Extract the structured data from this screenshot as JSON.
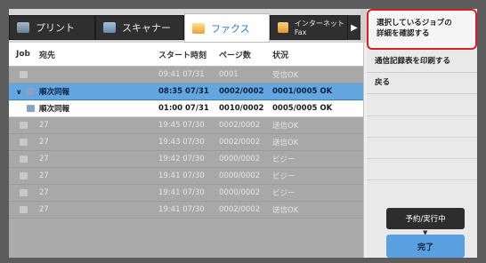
{
  "tabs": [
    {
      "label": "プリント",
      "icon": "printer-icon"
    },
    {
      "label": "スキャナー",
      "icon": "scanner-icon"
    },
    {
      "label": "ファクス",
      "icon": "fax-icon",
      "active": true
    },
    {
      "label": "インターネットFax",
      "icon": "internet-fax-icon"
    }
  ],
  "tab_more": "▶",
  "table": {
    "headers": [
      "Job",
      "宛先",
      "スタート時刻",
      "ページ数",
      "状況"
    ],
    "rows": [
      {
        "dest": "",
        "time": "09:41 07/31",
        "pages": "0001",
        "status": "受信OK",
        "style": "dim"
      },
      {
        "dest": "順次同報",
        "time": "08:35 07/31",
        "pages": "0002/0002",
        "status": "0001/0005 OK",
        "style": "sel"
      },
      {
        "dest": "順次同報",
        "time": "01:00 07/31",
        "pages": "0010/0002",
        "status": "0005/0005 OK",
        "style": "white"
      },
      {
        "dest": "27",
        "time": "19:45 07/30",
        "pages": "0002/0002",
        "status": "送信OK",
        "style": "dim"
      },
      {
        "dest": "27",
        "time": "19:43 07/30",
        "pages": "0002/0002",
        "status": "送信OK",
        "style": "dim"
      },
      {
        "dest": "27",
        "time": "19:42 07/30",
        "pages": "0000/0002",
        "status": "ビジー",
        "style": "dim"
      },
      {
        "dest": "27",
        "time": "19:41 07/30",
        "pages": "0000/0002",
        "status": "ビジー",
        "style": "dim"
      },
      {
        "dest": "27",
        "time": "19:41 07/30",
        "pages": "0000/0002",
        "status": "ビジー",
        "style": "dim"
      },
      {
        "dest": "27",
        "time": "19:41 07/30",
        "pages": "0002/0002",
        "status": "送信OK",
        "style": "dim"
      }
    ]
  },
  "scroll": {
    "up": "≜",
    "down": "≚"
  },
  "panel": {
    "check_details": "選択しているジョブの\n詳細を確認する",
    "print_log": "通信記録表を印刷する",
    "back": "戻る",
    "reserve_button": "予約/実行中",
    "done_button": "完了"
  },
  "colors": {
    "accent": "#2a78c8",
    "selected_row": "#63a6e0",
    "highlight_border": "#d4202a",
    "done_button": "#5a9fe0"
  }
}
